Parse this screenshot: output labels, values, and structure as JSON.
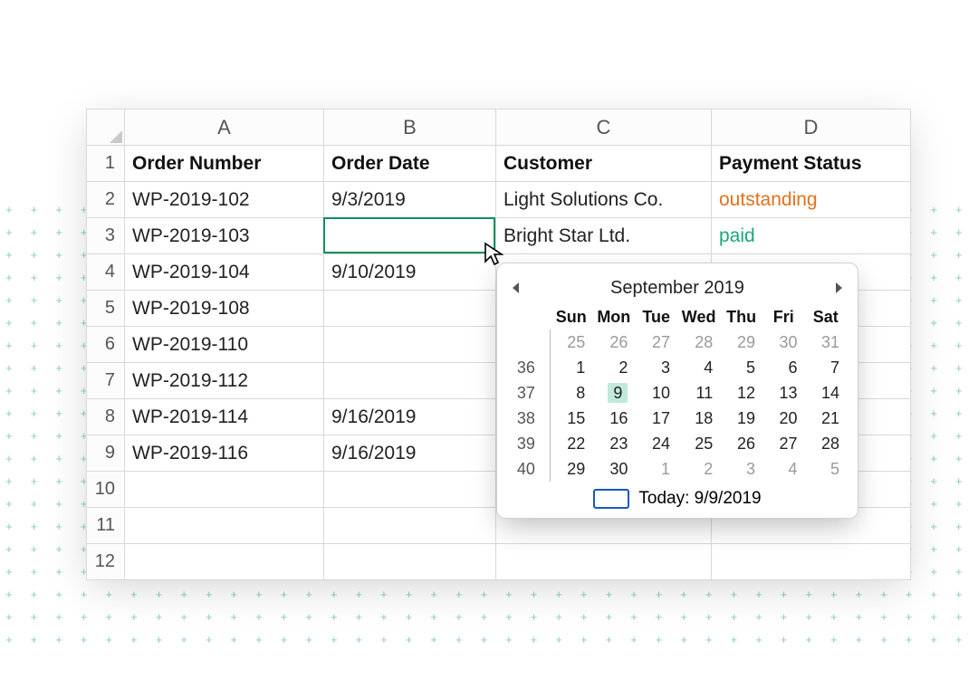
{
  "spreadsheet": {
    "columns": [
      "A",
      "B",
      "C",
      "D"
    ],
    "row_numbers": [
      1,
      2,
      3,
      4,
      5,
      6,
      7,
      8,
      9,
      10,
      11,
      12
    ],
    "headers": {
      "order_number": "Order Number",
      "order_date": "Order Date",
      "customer": "Customer",
      "payment_status": "Payment Status"
    },
    "rows": [
      {
        "order_number": "WP-2019-102",
        "order_date": "9/3/2019",
        "customer": "Light Solutions Co.",
        "payment_status": "outstanding",
        "status_class": "out"
      },
      {
        "order_number": "WP-2019-103",
        "order_date": "",
        "customer": "Bright Star Ltd.",
        "payment_status": "paid",
        "status_class": "paid"
      },
      {
        "order_number": "WP-2019-104",
        "order_date": "9/10/2019",
        "customer": "",
        "payment_status": ""
      },
      {
        "order_number": "WP-2019-108",
        "order_date": "",
        "customer": "",
        "payment_status": ""
      },
      {
        "order_number": "WP-2019-110",
        "order_date": "",
        "customer": "",
        "payment_status": ""
      },
      {
        "order_number": "WP-2019-112",
        "order_date": "",
        "customer": "",
        "payment_status": ""
      },
      {
        "order_number": "WP-2019-114",
        "order_date": "9/16/2019",
        "customer": "",
        "payment_status": ""
      },
      {
        "order_number": "WP-2019-116",
        "order_date": "9/16/2019",
        "customer": "",
        "payment_status": ""
      }
    ],
    "selected_cell": "B3",
    "colors": {
      "selection": "#0a8f5b",
      "status_outstanding": "#e2711d",
      "status_paid": "#19a974"
    }
  },
  "datepicker": {
    "title": "September 2019",
    "day_headers": [
      "Sun",
      "Mon",
      "Tue",
      "Wed",
      "Thu",
      "Fri",
      "Sat"
    ],
    "weeks": [
      {
        "wk": "",
        "days": [
          {
            "n": "25",
            "o": true
          },
          {
            "n": "26",
            "o": true
          },
          {
            "n": "27",
            "o": true
          },
          {
            "n": "28",
            "o": true
          },
          {
            "n": "29",
            "o": true
          },
          {
            "n": "30",
            "o": true
          },
          {
            "n": "31",
            "o": true
          }
        ]
      },
      {
        "wk": "36",
        "days": [
          {
            "n": "1"
          },
          {
            "n": "2"
          },
          {
            "n": "3"
          },
          {
            "n": "4"
          },
          {
            "n": "5"
          },
          {
            "n": "6"
          },
          {
            "n": "7"
          }
        ]
      },
      {
        "wk": "37",
        "days": [
          {
            "n": "8"
          },
          {
            "n": "9",
            "today": true
          },
          {
            "n": "10"
          },
          {
            "n": "11"
          },
          {
            "n": "12"
          },
          {
            "n": "13"
          },
          {
            "n": "14"
          }
        ]
      },
      {
        "wk": "38",
        "days": [
          {
            "n": "15"
          },
          {
            "n": "16"
          },
          {
            "n": "17"
          },
          {
            "n": "18"
          },
          {
            "n": "19"
          },
          {
            "n": "20"
          },
          {
            "n": "21"
          }
        ]
      },
      {
        "wk": "39",
        "days": [
          {
            "n": "22"
          },
          {
            "n": "23"
          },
          {
            "n": "24"
          },
          {
            "n": "25"
          },
          {
            "n": "26"
          },
          {
            "n": "27"
          },
          {
            "n": "28"
          }
        ]
      },
      {
        "wk": "40",
        "days": [
          {
            "n": "29"
          },
          {
            "n": "30"
          },
          {
            "n": "1",
            "o": true
          },
          {
            "n": "2",
            "o": true
          },
          {
            "n": "3",
            "o": true
          },
          {
            "n": "4",
            "o": true
          },
          {
            "n": "5",
            "o": true
          }
        ]
      }
    ],
    "today_label": "Today: 9/9/2019"
  }
}
